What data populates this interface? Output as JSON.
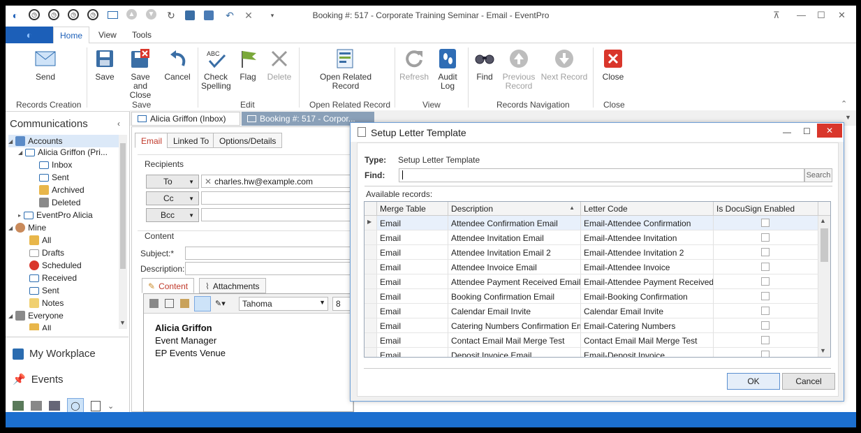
{
  "window": {
    "title": "Booking #: 517 - Corporate Training Seminar - Email - EventPro"
  },
  "ribbon": {
    "tabs": [
      "Home",
      "View",
      "Tools"
    ],
    "groups": {
      "records_creation": "Records Creation",
      "save": "Save",
      "edit": "Edit",
      "open_related": "Open Related Record",
      "view": "View",
      "navigation": "Records Navigation",
      "close": "Close"
    },
    "buttons": {
      "send": "Send",
      "save": "Save",
      "save_close_1": "Save and",
      "save_close_2": "Close",
      "cancel": "Cancel",
      "check_1": "Check",
      "check_2": "Spelling",
      "flag": "Flag",
      "delete": "Delete",
      "open_related_1": "Open Related",
      "open_related_2": "Record",
      "refresh": "Refresh",
      "audit_1": "Audit",
      "audit_2": "Log",
      "find": "Find",
      "prev_1": "Previous",
      "prev_2": "Record",
      "next": "Next Record",
      "close": "Close"
    },
    "colors": {
      "accent": "#1c5fb8",
      "status": "#1c6fcf"
    }
  },
  "sidebar": {
    "header": "Communications",
    "tree": {
      "accounts": "Accounts",
      "alicia": "Alicia Griffon (Pri...",
      "inbox": "Inbox",
      "sent": "Sent",
      "archived": "Archived",
      "deleted": "Deleted",
      "eventpro": "EventPro Alicia",
      "mine": "Mine",
      "all": "All",
      "drafts": "Drafts",
      "scheduled": "Scheduled",
      "received": "Received",
      "sent2": "Sent",
      "notes": "Notes",
      "everyone": "Everyone",
      "all2": "All"
    },
    "nav": {
      "workplace": "My Workplace",
      "events": "Events"
    }
  },
  "doc_tabs": {
    "inbox": "Alicia Griffon (Inbox)",
    "booking": "Booking #: 517 - Corpor..."
  },
  "editor": {
    "tabs": {
      "email": "Email",
      "linked": "Linked To",
      "options": "Options/Details"
    },
    "recipients_label": "Recipients",
    "to": "To",
    "cc": "Cc",
    "bcc": "Bcc",
    "to_value": "charles.hw@example.com",
    "content_label": "Content",
    "subject_label": "Subject:*",
    "description_label": "Description:",
    "content_tab": "Content",
    "attachments_tab": "Attachments",
    "font": "Tahoma",
    "font_size": "8",
    "body": {
      "name": "Alicia Griffon",
      "title": "Event Manager",
      "venue": "EP Events Venue"
    }
  },
  "dialog": {
    "title": "Setup Letter Template",
    "type_label": "Type:",
    "type_value": "Setup Letter Template",
    "find_label": "Find:",
    "search": "Search",
    "available": "Available records:",
    "columns": [
      "Merge Table",
      "Description",
      "Letter Code",
      "Is DocuSign Enabled"
    ],
    "rows": [
      [
        "Email",
        "Attendee Confirmation Email",
        "Email-Attendee Confirmation"
      ],
      [
        "Email",
        "Attendee Invitation Email",
        "Email-Attendee Invitation"
      ],
      [
        "Email",
        "Attendee Invitation Email 2",
        "Email-Attendee Invitation 2"
      ],
      [
        "Email",
        "Attendee Invoice Email",
        "Email-Attendee Invoice"
      ],
      [
        "Email",
        "Attendee Payment Received Email",
        "Email-Attendee Payment Received"
      ],
      [
        "Email",
        "Booking Confirmation Email",
        "Email-Booking Confirmation"
      ],
      [
        "Email",
        "Calendar Email Invite",
        "Calendar Email Invite"
      ],
      [
        "Email",
        "Catering Numbers Confirmation Email",
        "Email-Catering Numbers"
      ],
      [
        "Email",
        "Contact Email Mail Merge Test",
        "Contact Email Mail Merge Test"
      ],
      [
        "Email",
        "Deposit Invoice Email",
        "Email-Deposit Invoice"
      ]
    ],
    "ok": "OK",
    "cancel": "Cancel"
  }
}
